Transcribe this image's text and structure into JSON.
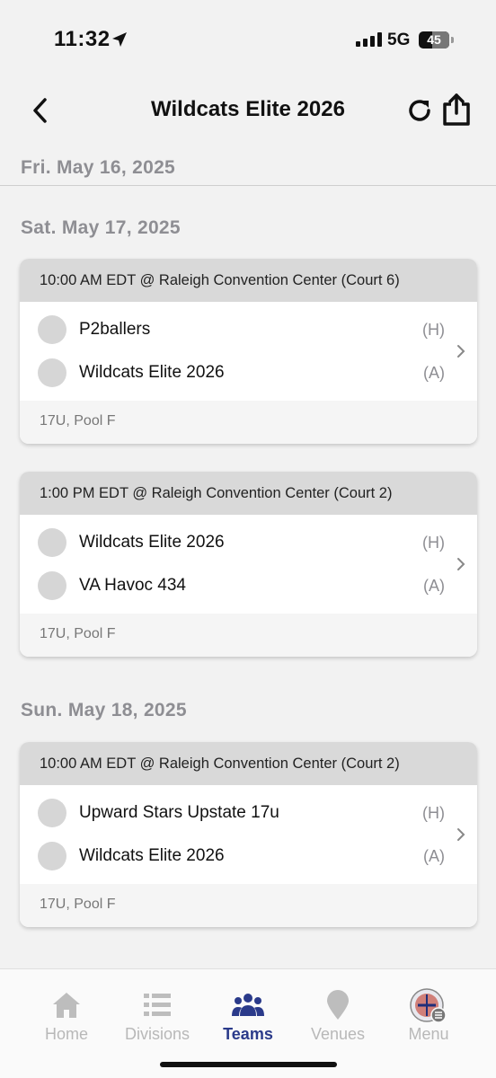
{
  "status_bar": {
    "time": "11:32",
    "network": "5G",
    "battery": "45"
  },
  "nav": {
    "title": "Wildcats Elite 2026"
  },
  "days": [
    {
      "date": "Fri. May 16, 2025",
      "games": []
    },
    {
      "date": "Sat. May 17, 2025",
      "games": [
        {
          "header": "10:00 AM EDT @ Raleigh Convention Center (Court 6)",
          "home": "P2ballers",
          "home_tag": "(H)",
          "away": "Wildcats Elite 2026",
          "away_tag": "(A)",
          "footer": "17U, Pool F"
        },
        {
          "header": "1:00 PM EDT @ Raleigh Convention Center (Court 2)",
          "home": "Wildcats Elite 2026",
          "home_tag": "(H)",
          "away": "VA Havoc 434",
          "away_tag": "(A)",
          "footer": "17U, Pool F"
        }
      ]
    },
    {
      "date": "Sun. May 18, 2025",
      "games": [
        {
          "header": "10:00 AM EDT @ Raleigh Convention Center (Court 2)",
          "home": "Upward Stars Upstate 17u",
          "home_tag": "(H)",
          "away": "Wildcats Elite 2026",
          "away_tag": "(A)",
          "footer": "17U, Pool F"
        }
      ]
    }
  ],
  "tabs": [
    {
      "label": "Home",
      "icon": "home-icon"
    },
    {
      "label": "Divisions",
      "icon": "divisions-icon"
    },
    {
      "label": "Teams",
      "icon": "teams-icon",
      "active": true
    },
    {
      "label": "Venues",
      "icon": "venue-pin-icon"
    },
    {
      "label": "Menu",
      "icon": "menu-logo-icon"
    }
  ],
  "colors": {
    "accent": "#2a3a8a",
    "background": "#f2f2f2",
    "card_header": "#d9d9d9",
    "muted_text": "#8e8e93"
  }
}
